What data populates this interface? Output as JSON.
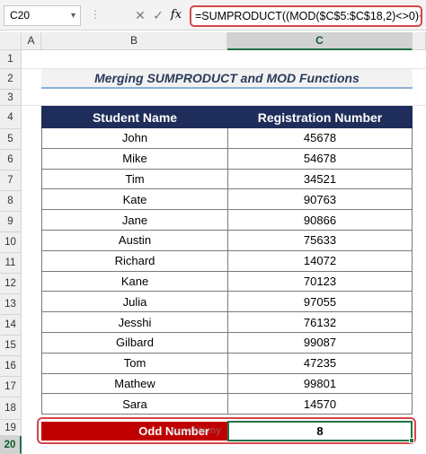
{
  "formula_bar": {
    "name_box": "C20",
    "cancel_icon": "✕",
    "enter_icon": "✓",
    "fx_label": "fx",
    "formula": "=SUMPRODUCT((MOD($C$5:$C$18,2)<>0)+0)"
  },
  "columns": [
    "",
    "A",
    "B",
    "C",
    ""
  ],
  "rows": [
    "1",
    "2",
    "3",
    "4",
    "5",
    "6",
    "7",
    "8",
    "9",
    "10",
    "11",
    "12",
    "13",
    "14",
    "15",
    "16",
    "17",
    "18",
    "19",
    "20"
  ],
  "title": "Merging SUMPRODUCT and MOD Functions",
  "table": {
    "headers": [
      "Student Name",
      "Registration Number"
    ],
    "rows": [
      [
        "John",
        "45678"
      ],
      [
        "Mike",
        "54678"
      ],
      [
        "Tim",
        "34521"
      ],
      [
        "Kate",
        "90763"
      ],
      [
        "Jane",
        "90866"
      ],
      [
        "Austin",
        "75633"
      ],
      [
        "Richard",
        "14072"
      ],
      [
        "Kane",
        "70123"
      ],
      [
        "Julia",
        "97055"
      ],
      [
        "Jesshi",
        "76132"
      ],
      [
        "Gilbard",
        "99087"
      ],
      [
        "Tom",
        "47235"
      ],
      [
        "Mathew",
        "99801"
      ],
      [
        "Sara",
        "14570"
      ]
    ]
  },
  "result": {
    "label": "Odd Number",
    "value": "8"
  },
  "watermark": "exceldemy",
  "colors": {
    "header_fill": "#1f2d5a",
    "result_fill": "#c00000",
    "highlight": "#d6474a",
    "selection": "#217346"
  }
}
